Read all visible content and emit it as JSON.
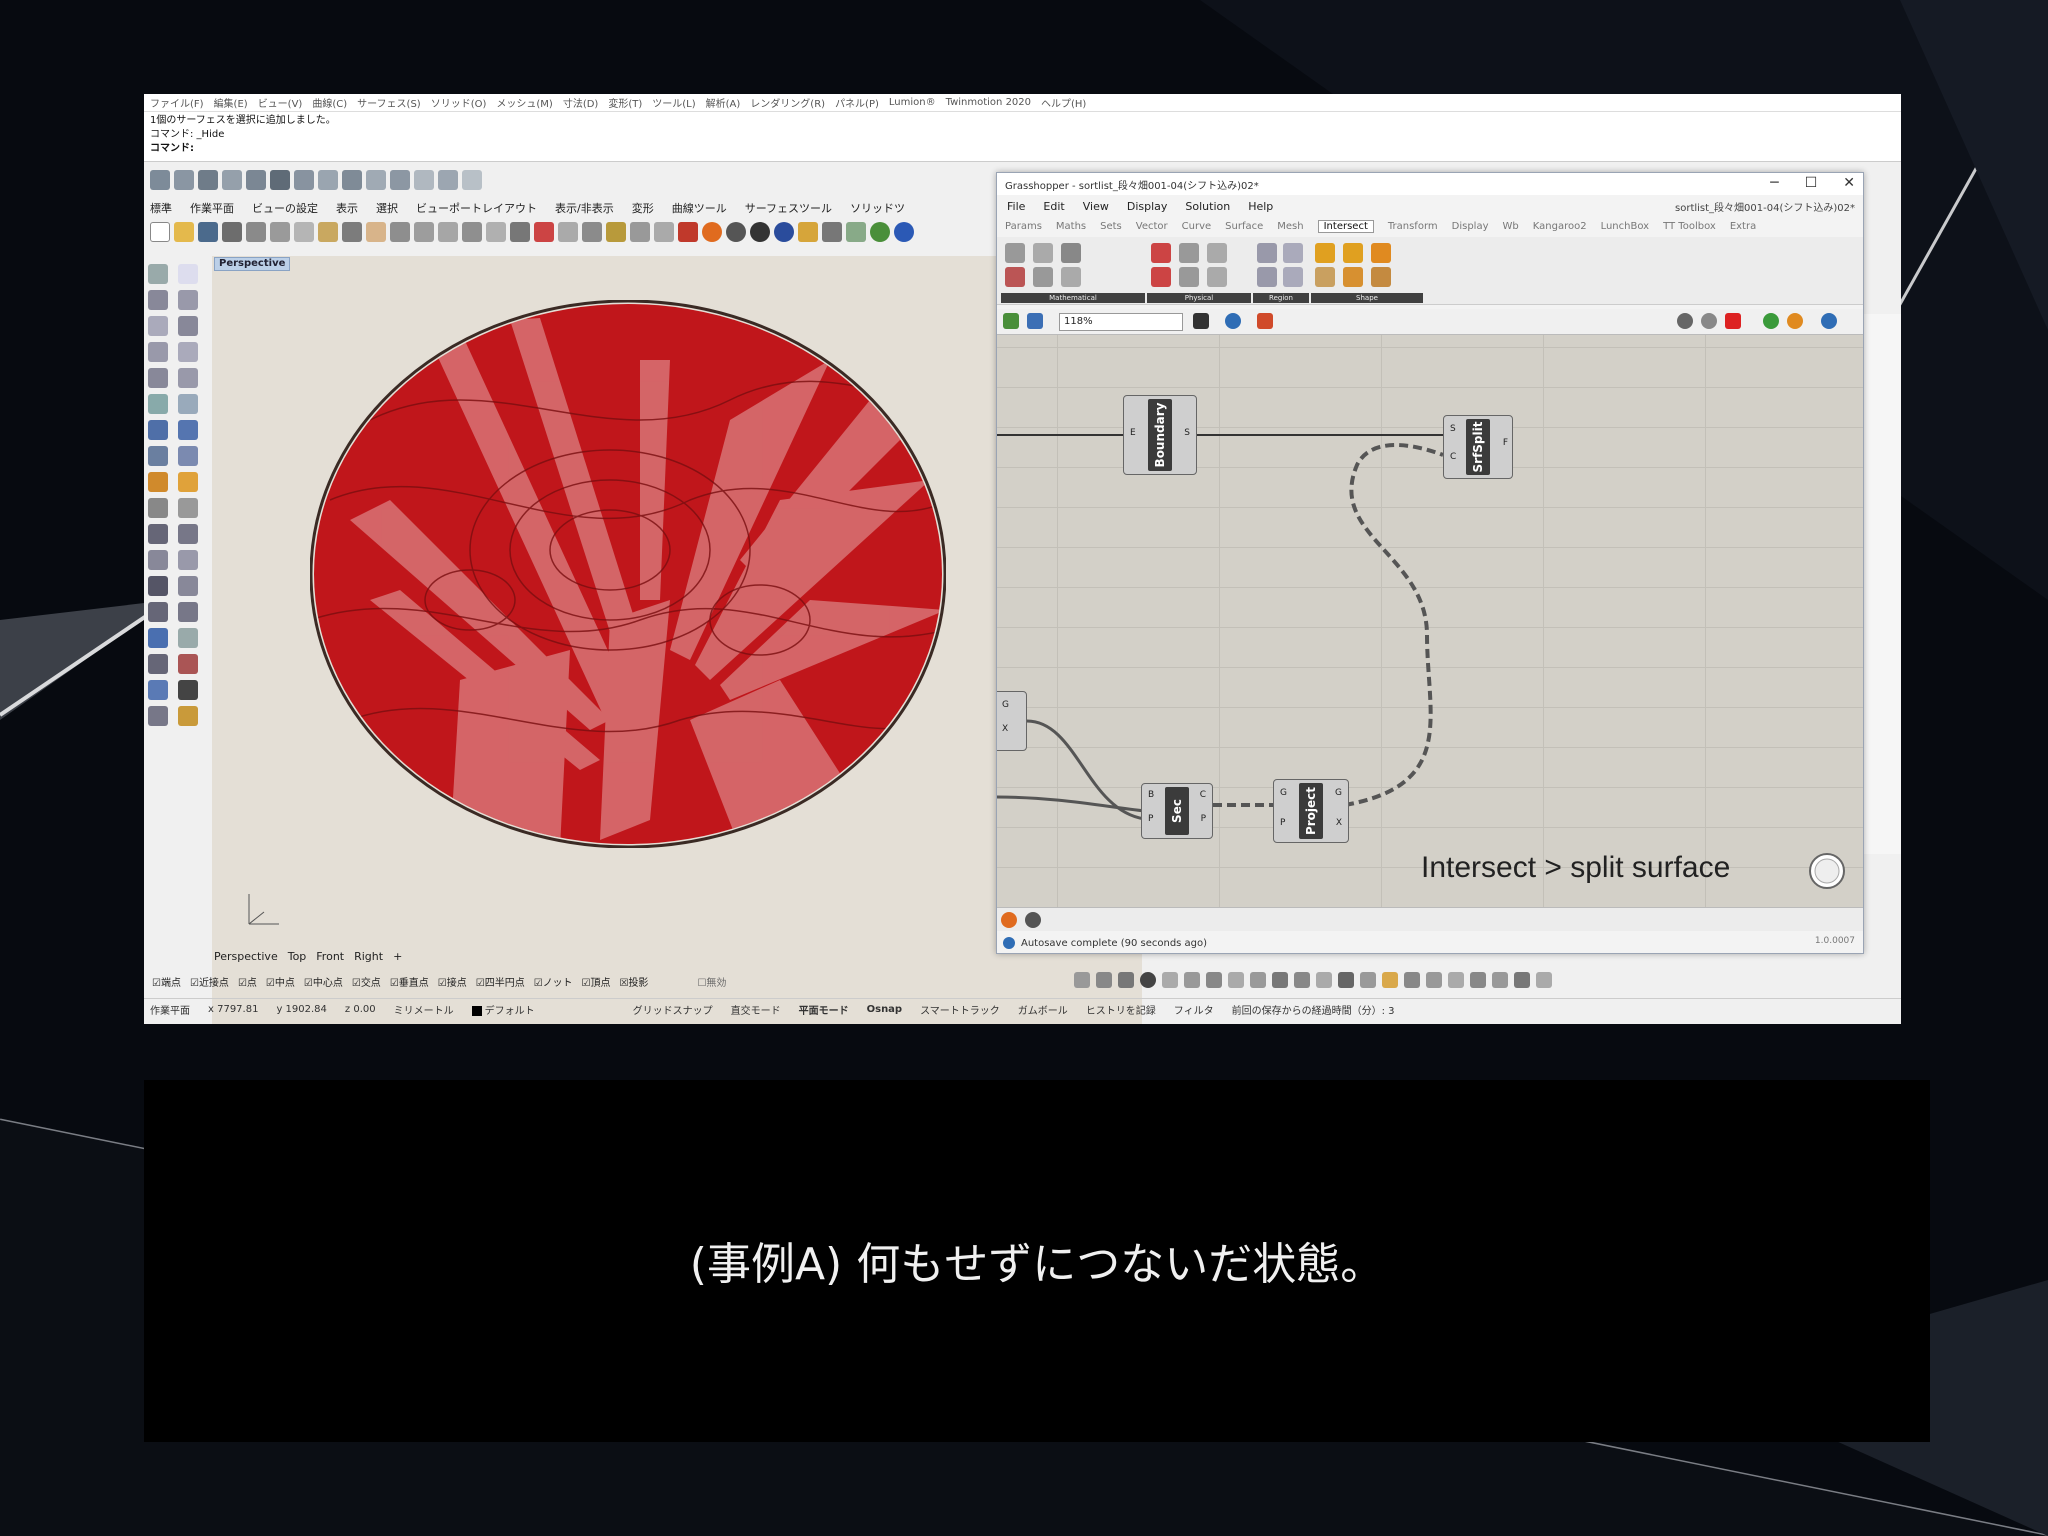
{
  "rhino": {
    "menu_items": [
      "ファイル(F)",
      "編集(E)",
      "ビュー(V)",
      "曲線(C)",
      "サーフェス(S)",
      "ソリッド(O)",
      "メッシュ(M)",
      "寸法(D)",
      "変形(T)",
      "ツール(L)",
      "解析(A)",
      "レンダリング(R)",
      "パネル(P)",
      "Lumion®",
      "Twinmotion 2020",
      "ヘルプ(H)"
    ],
    "command_history_1": "1個のサーフェスを選択に追加しました。",
    "command_history_2": "コマンド: _Hide",
    "command_prompt": "コマンド:",
    "toolbar_tabs": [
      "標準",
      "作業平面",
      "ビューの設定",
      "表示",
      "選択",
      "ビューポートレイアウト",
      "表示/非表示",
      "変形",
      "曲線ツール",
      "サーフェスツール",
      "ソリッドツ"
    ],
    "viewport_label": "Perspective",
    "viewport_tabs": [
      "Perspective",
      "Top",
      "Front",
      "Right"
    ],
    "osnaps": [
      "端点",
      "近接点",
      "点",
      "中点",
      "中心点",
      "交点",
      "垂直点",
      "接点",
      "四半円点",
      "ノット",
      "頂点",
      "投影",
      "無効"
    ],
    "status": {
      "cplane": "作業平面",
      "x": "x 7797.81",
      "y": "y 1902.84",
      "z": "z 0.00",
      "units": "ミリメートル",
      "layer": "デフォルト",
      "modes": [
        "グリッドスナップ",
        "直交モード",
        "平面モード",
        "Osnap",
        "スマートトラック",
        "ガムボール",
        "ヒストリを記録",
        "フィルタ"
      ],
      "autosave": "前回の保存からの経過時間（分）: 3"
    },
    "colors": {
      "surface_red": "#c0161b",
      "viewport_bg": "#e4dfd6"
    }
  },
  "grasshopper": {
    "title": "Grasshopper - sortlist_段々畑001-04(シフト込み)02*",
    "menu": [
      "File",
      "Edit",
      "View",
      "Display",
      "Solution",
      "Help"
    ],
    "doc_name": "sortlist_段々畑001-04(シフト込み)02*",
    "tabs": [
      "Params",
      "Maths",
      "Sets",
      "Vector",
      "Curve",
      "Surface",
      "Mesh",
      "Intersect",
      "Transform",
      "Display",
      "Wb",
      "Kangaroo2",
      "LunchBox",
      "TT Toolbox",
      "Extra"
    ],
    "active_tab": "Intersect",
    "ribbon_groups": [
      "Mathematical",
      "Physical",
      "Region",
      "Shape"
    ],
    "zoom": "118%",
    "nodes": {
      "boundary": {
        "label": "Boundary",
        "in": "E",
        "out": "S"
      },
      "srfsplit": {
        "label": "SrfSplit",
        "in1": "S",
        "in2": "C",
        "out": "F"
      },
      "geo": {
        "out1": "G",
        "out2": "X"
      },
      "sec": {
        "label": "Sec",
        "in1": "B",
        "in2": "P",
        "out1": "C",
        "out2": "P"
      },
      "project": {
        "label": "Project",
        "in1": "G",
        "in2": "P",
        "out1": "G",
        "out2": "X"
      }
    },
    "caption": "Intersect > split surface",
    "status": "Autosave complete (90 seconds ago)",
    "version": "1.0.0007"
  },
  "subtitle": "(事例A) 何もせずにつないだ状態。"
}
